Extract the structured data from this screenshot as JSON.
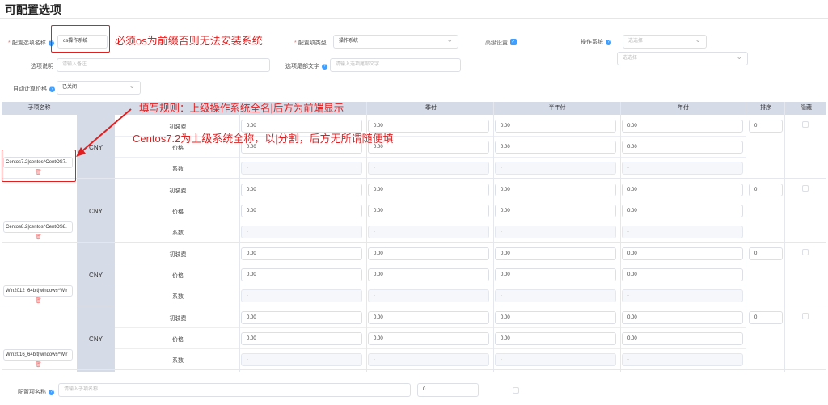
{
  "page_title": "可配置选项",
  "form": {
    "config_name_label": "配置选项名称",
    "config_name_value": "os操作系统",
    "config_type_label": "配置项类型",
    "config_type_value": "操作系统",
    "advanced_label": "高级设置",
    "os_label": "操作系统",
    "os_select1_placeholder": "选选择",
    "os_select2_placeholder": "选选择",
    "desc_label": "选项说明",
    "desc_placeholder": "请输入备注",
    "suffix_label": "选项尾部文字",
    "suffix_placeholder": "请输入选项尾部文字",
    "auto_price_label": "自动计算价格",
    "auto_price_value": "已关闭"
  },
  "table": {
    "headers": {
      "sub_name": "子项名称",
      "quarter": "季付",
      "half_year": "半年付",
      "year": "年付",
      "sort": "排序",
      "hidden": "隐藏"
    },
    "row_labels": {
      "setup": "初装费",
      "price": "价格",
      "coef": "系数"
    },
    "rows": [
      {
        "name": "Centos7.2|centos^CentOS7.",
        "currency": "CNY",
        "setup": [
          "0.00",
          "0.00",
          "0.00",
          "0.00"
        ],
        "price": [
          "0.00",
          "0.00",
          "0.00",
          "0.00"
        ],
        "coef": [
          "-",
          "-",
          "-",
          "-"
        ],
        "sort": "0"
      },
      {
        "name": "Centos8.2|centos^CentOS8.",
        "currency": "CNY",
        "setup": [
          "0.00",
          "0.00",
          "0.00",
          "0.00"
        ],
        "price": [
          "0.00",
          "0.00",
          "0.00",
          "0.00"
        ],
        "coef": [
          "-",
          "-",
          "-",
          "-"
        ],
        "sort": "0"
      },
      {
        "name": "Win2012_64bit|windows^Wir",
        "currency": "CNY",
        "setup": [
          "0.00",
          "0.00",
          "0.00",
          "0.00"
        ],
        "price": [
          "0.00",
          "0.00",
          "0.00",
          "0.00"
        ],
        "coef": [
          "-",
          "-",
          "-",
          "-"
        ],
        "sort": "0"
      },
      {
        "name": "Win2016_64bit|windows^Wir",
        "currency": "CNY",
        "setup": [
          "0.00",
          "0.00",
          "0.00",
          "0.00"
        ],
        "price": [
          "0.00",
          "0.00",
          "0.00",
          "0.00"
        ],
        "coef": [
          "-",
          "-",
          "-",
          "-"
        ],
        "sort": "0"
      }
    ]
  },
  "footer": {
    "label": "配置项名称",
    "placeholder": "请输入子项名称",
    "sort_value": "0"
  },
  "annotations": {
    "a1": "必须os为前缀否则无法安装系统",
    "a2": "填写规则：上级操作系统全名|后方为前端显示",
    "a3": "Centos7.2为上级系统全称，以|分割，后方无所谓随便填"
  },
  "colors": {
    "annotation": "#e02020",
    "header_bg": "#d6dbe8",
    "accent": "#409eff"
  }
}
